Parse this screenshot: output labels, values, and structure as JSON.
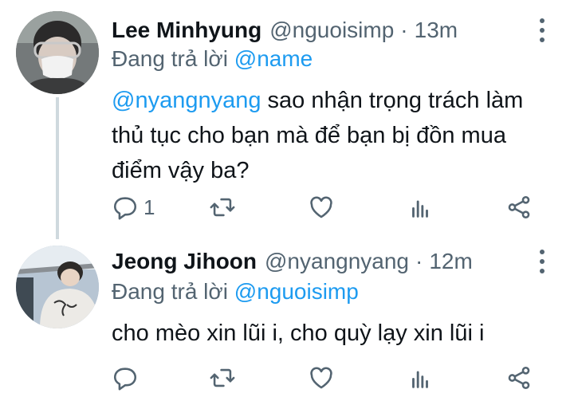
{
  "tweets": [
    {
      "name": "Lee Minhyung",
      "handle": "@nguoisimp",
      "separator": "·",
      "time": "13m",
      "reply_prefix": "Đang trả lời",
      "reply_to": "@name",
      "mention": "@nyangnyang",
      "text": " sao nhận trọng trách làm thủ tục cho bạn mà để bạn bị đồn mua điểm vậy ba?",
      "reply_count": "1",
      "icons": [
        "reply-icon",
        "retweet-icon",
        "like-icon",
        "analytics-icon",
        "share-icon",
        "more-icon"
      ]
    },
    {
      "name": "Jeong Jihoon",
      "handle": "@nyangnyang",
      "separator": "·",
      "time": "12m",
      "reply_prefix": "Đang trả lời",
      "reply_to": "@nguoisimp",
      "text": "cho mèo xin lũi i, cho quỳ lạy xin lũi i",
      "reply_count": "",
      "icons": [
        "reply-icon",
        "retweet-icon",
        "like-icon",
        "analytics-icon",
        "share-icon",
        "more-icon"
      ]
    }
  ],
  "colors": {
    "accent": "#1d9bf0",
    "muted": "#536471",
    "text": "#0f1419",
    "thread_line": "#cfd9de"
  }
}
